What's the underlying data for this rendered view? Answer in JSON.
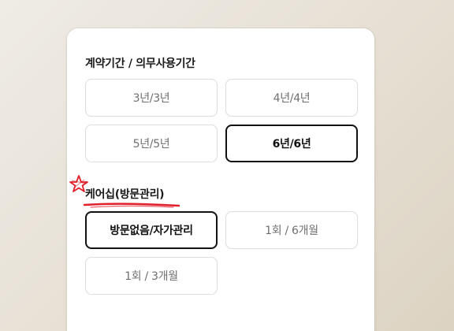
{
  "contract": {
    "title": "계약기간 / 의무사용기간",
    "options": [
      {
        "label": "3년/3년",
        "selected": false
      },
      {
        "label": "4년/4년",
        "selected": false
      },
      {
        "label": "5년/5년",
        "selected": false
      },
      {
        "label": "6년/6년",
        "selected": true
      }
    ]
  },
  "care": {
    "title": "케어십(방문관리)",
    "options": [
      {
        "label": "방문없음/자가관리",
        "selected": true
      },
      {
        "label": "1회 / 6개월",
        "selected": false
      },
      {
        "label": "1회 / 3개월",
        "selected": false
      }
    ]
  },
  "colors": {
    "accent_mark": "#e0202a",
    "selected_border": "#111111"
  },
  "icons": {
    "star": "hand-drawn-star-icon",
    "underline": "hand-drawn-underline"
  }
}
